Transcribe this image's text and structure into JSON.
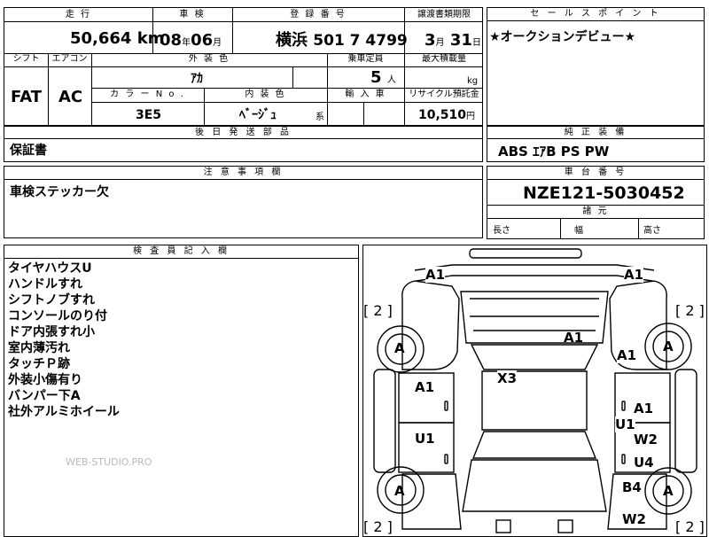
{
  "main_table": {
    "mileage_label": "走 行",
    "mileage_value": "50,664",
    "mileage_unit": "km",
    "shaken_label": "車 検",
    "shaken_year": "08",
    "shaken_year_unit": "年",
    "shaken_month": "06",
    "shaken_month_unit": "月",
    "reg_label": "登 録 番 号",
    "reg_place": "横浜",
    "reg_number": "501 7 4799",
    "transfer_label": "譲渡書類期限",
    "transfer_month": "3",
    "transfer_month_unit": "月",
    "transfer_day": "31",
    "transfer_day_unit": "日",
    "shift_label": "シフト",
    "shift_value": "FAT",
    "aircon_label": "エアコン",
    "aircon_value": "AC",
    "exterior_color_label": "外 装 色",
    "exterior_color_value": "ｱｶ",
    "capacity_label": "乗車定員",
    "capacity_value": "5",
    "capacity_unit": "人",
    "maxload_label": "最大積載量",
    "maxload_unit": "kg",
    "color_no_label": "カ ラ ー N o .",
    "color_no_value": "3E5",
    "interior_color_label": "内 装 色",
    "interior_color_value": "ﾍﾞｰｼﾞｭ",
    "interior_color_suffix": "系",
    "import_label": "輸 入 車",
    "recycle_label": "リサイクル預託金",
    "recycle_value": "10,510",
    "recycle_unit": "円",
    "later_parts_label": "後 日 発 送 部 品",
    "later_parts_value": "保証書"
  },
  "sales_point": {
    "label": "セ ー ル ス ポ イ ン ト",
    "text": "★オークションデビュー★"
  },
  "standard_equipment": {
    "label": "純 正 装 備",
    "text": "ABS ｴｱB PS PW"
  },
  "notes": {
    "label": "注 意 事 項 欄",
    "text": "車検ステッカー欠"
  },
  "chassis": {
    "label": "車 台 番 号",
    "value": "NZE121-5030452",
    "spec_label": "諸 元",
    "length_label": "長さ",
    "width_label": "幅",
    "height_label": "高さ"
  },
  "inspector": {
    "label": "検 査 員 記 入 欄",
    "items": [
      "タイヤハウスU",
      "ハンドルすれ",
      "シフトノブすれ",
      "コンソールのり付",
      "ドア内張すれ小",
      "室内薄汚れ",
      "タッチＰ跡",
      "外装小傷有り",
      "バンパー下A",
      "社外アルミホイール"
    ]
  },
  "watermark": "WEB-STUDIO.PRO",
  "diagram": {
    "tire_count_label": "[ 2 ]",
    "tire_grade": "A",
    "damage_marks": {
      "front_left": "A1",
      "front_right": "A1",
      "hood": "A1",
      "right_fender": "A1",
      "roof": "X3",
      "left_front_door": "A1",
      "left_rear_door": "U1",
      "right_front_door": "A1",
      "right_door_u1": "U1",
      "right_door_w2": "W2",
      "right_rear_u4": "U4",
      "right_rear_b4": "B4",
      "rear_w2": "W2"
    }
  }
}
